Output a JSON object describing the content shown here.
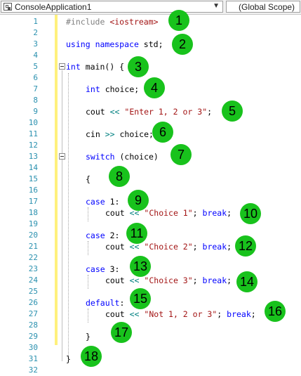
{
  "toolbar": {
    "project": "ConsoleApplication1",
    "scope": "(Global Scope)"
  },
  "line_numbers": [
    "1",
    "2",
    "3",
    "4",
    "5",
    "6",
    "7",
    "8",
    "9",
    "10",
    "11",
    "12",
    "13",
    "14",
    "15",
    "16",
    "17",
    "18",
    "19",
    "20",
    "21",
    "22",
    "23",
    "24",
    "25",
    "26",
    "27",
    "28",
    "29",
    "30",
    "31",
    "32"
  ],
  "code": {
    "l1_pp": "#include",
    "l1_str": "<iostream>",
    "l3_kw1": "using",
    "l3_kw2": "namespace",
    "l3_rest": " std;",
    "l5_kw": "int",
    "l5_rest": " main() {",
    "l7_kw": "int",
    "l7_rest": " choice;",
    "l9_a": "cout ",
    "l9_op": "<<",
    "l9_str": "\"Enter 1, 2 or 3\"",
    "l9_end": ";",
    "l11_a": "cin ",
    "l11_op": ">>",
    "l11_b": " choice;",
    "l13_kw": "switch",
    "l13_rest": " (choice)",
    "l15": "{",
    "case1": "case",
    "case1_rest": " 1:",
    "l18_a": "cout ",
    "l18_op": "<<",
    "l18_str": "\"Choice 1\"",
    "l18_b": "; ",
    "l18_kw": "break",
    "l18_c": ";",
    "case2": "case",
    "case2_rest": " 2:",
    "l21_str": "\"Choice 2\"",
    "case3": "case",
    "case3_rest": " 3:",
    "l24_str": "\"Choice 3\"",
    "default_kw": "default",
    "default_rest": ":",
    "l27_str": "\"Not 1, 2 or 3\"",
    "l29": "}",
    "l31": "}"
  },
  "badges": [
    "1",
    "2",
    "3",
    "4",
    "5",
    "6",
    "7",
    "8",
    "9",
    "10",
    "11",
    "12",
    "13",
    "14",
    "15",
    "16",
    "17",
    "18"
  ],
  "colors": {
    "keyword": "#0000ff",
    "string": "#a31515",
    "operator": "#008080",
    "preprocessor": "#808080",
    "line_number": "#2b91af",
    "badge": "#18c21c",
    "change_margin": "#fff17d"
  }
}
